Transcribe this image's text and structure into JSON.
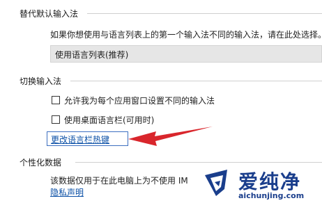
{
  "section_default_ime": {
    "title": "替代默认输入法",
    "description": "如果你想使用与语言列表上的第一个输入法不同的输入法，请在此处选择。",
    "select_value": "使用语言列表(推荐)"
  },
  "section_switch_ime": {
    "title": "切换输入法",
    "checkbox_per_app_label": "允许我为每个应用窗口设置不同的输入法",
    "checkbox_per_app_checked": false,
    "checkbox_desktop_bar_label": "使用桌面语言栏(可用时)",
    "checkbox_desktop_bar_checked": false,
    "hotkey_link": "更改语言栏热键"
  },
  "section_personalization": {
    "title": "个性化数据",
    "description": "该数据仅用于在此电脑上为不使用 IM",
    "privacy_link": "隐私声明"
  },
  "watermark": {
    "brand": "爱纯净",
    "url": "aichunjing.com",
    "accent_color": "#1a3e8c"
  },
  "annotation": {
    "arrow_color": "#d9262c"
  }
}
